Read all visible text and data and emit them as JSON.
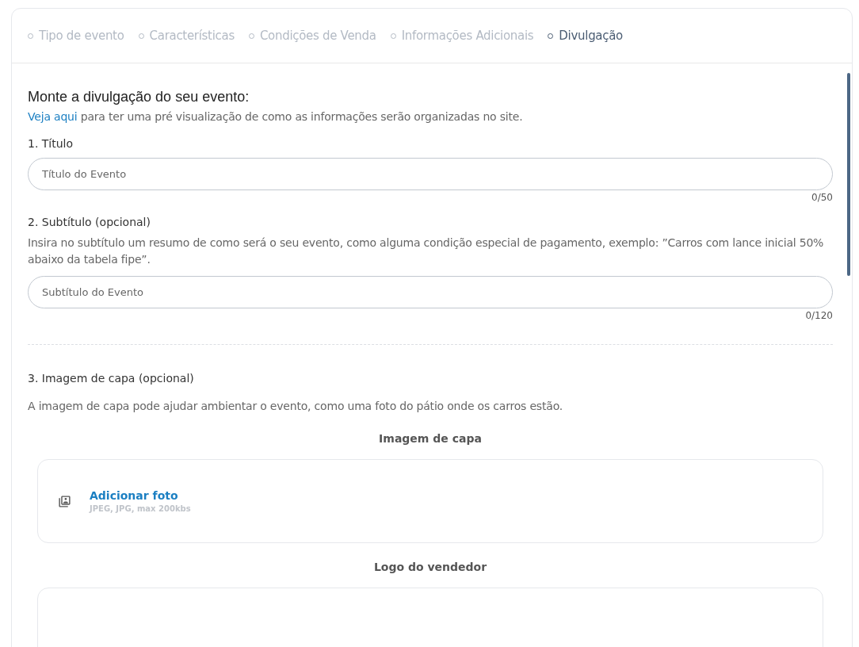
{
  "steps": [
    {
      "label": "Tipo de evento",
      "selected": false
    },
    {
      "label": "Características",
      "selected": false
    },
    {
      "label": "Condições de Venda",
      "selected": false
    },
    {
      "label": "Informações Adicionais",
      "selected": false
    },
    {
      "label": "Divulgação",
      "selected": true
    }
  ],
  "heading": "Monte a divulgação do seu evento:",
  "intro": {
    "link": "Veja aqui",
    "text": " para ter uma pré visualização de como as informações serão organizadas no site."
  },
  "title_field": {
    "label": "1. Título",
    "placeholder": "Título do Evento",
    "counter": "0/50"
  },
  "subtitle_field": {
    "label": "2. Subtítulo (opcional)",
    "hint": "Insira no subtítulo um resumo de como será o seu evento, como alguma condição especial de pagamento, exemplo: ”Carros com lance inicial 50% abaixo da tabela fipe”.",
    "placeholder": "Subtítulo do Evento",
    "counter": "0/120"
  },
  "image_section": {
    "label": "3. Imagem de capa (opcional)",
    "hint": "A imagem de capa pode ajudar ambientar o evento, como uma foto do pátio onde os carros estão."
  },
  "uploads": [
    {
      "title": "Imagem de capa",
      "action": "Adicionar foto",
      "formats": "JPEG, JPG, max 200kbs"
    },
    {
      "title": "Logo do vendedor"
    }
  ]
}
